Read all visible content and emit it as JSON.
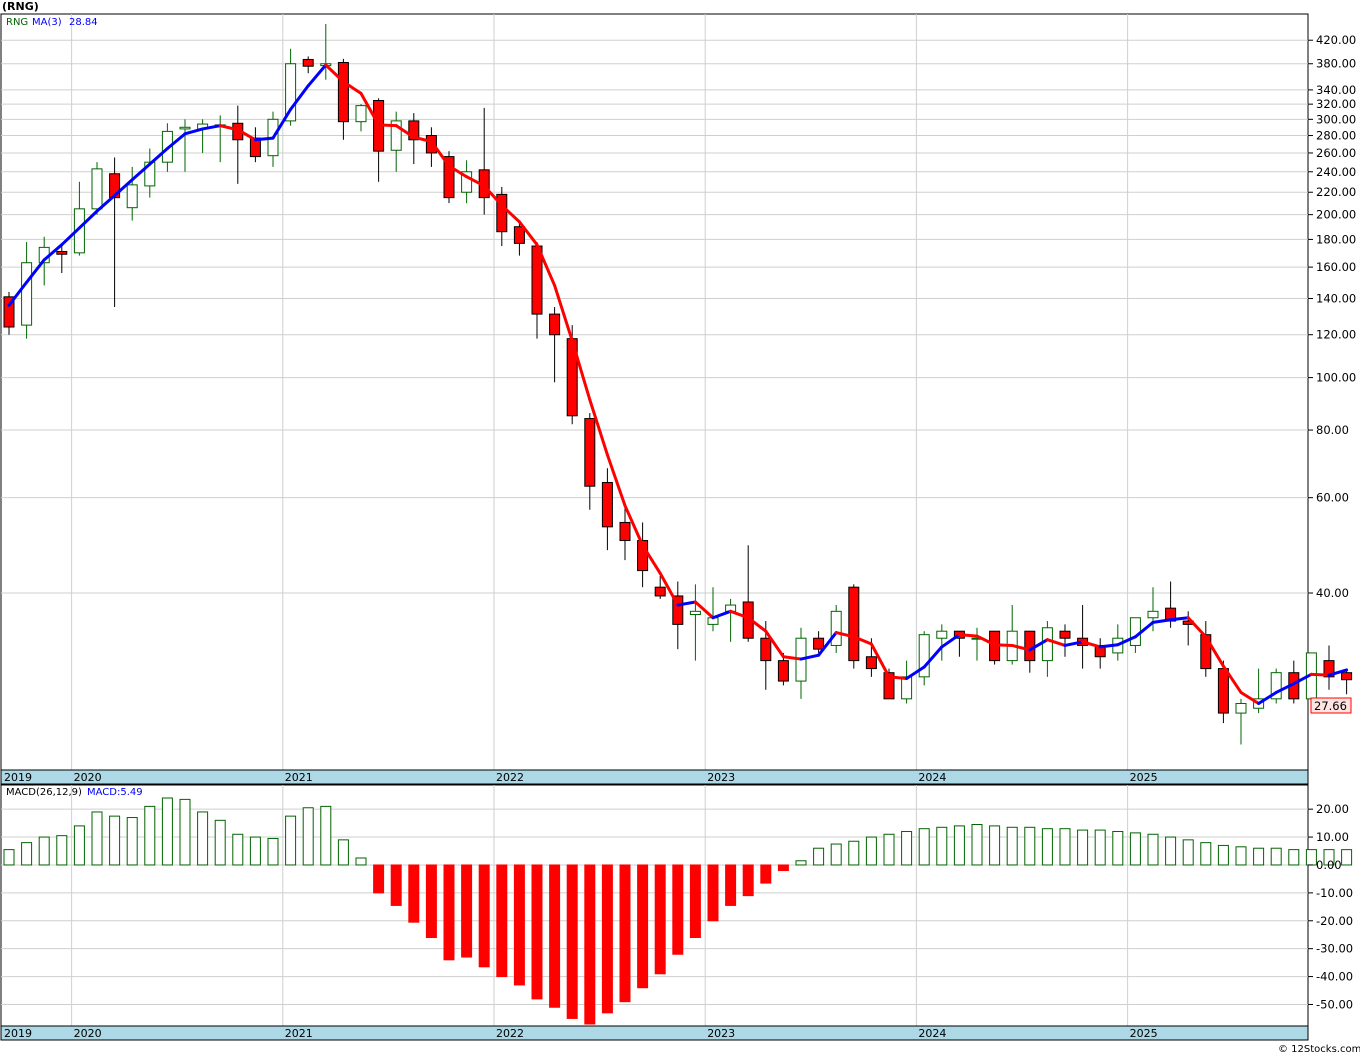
{
  "title": "(RNG)",
  "legend": {
    "symbol": "RNG",
    "ma_label": "MA(3)",
    "ma_value": "28.84"
  },
  "last_price": "27.66",
  "macd_label": "MACD(26,12,9)",
  "macd_value": "MACD:5.49",
  "watermark": "© 12Stocks.com",
  "colors": {
    "up": "#006400",
    "down": "#ff0000",
    "ma_up": "#0000ff",
    "ma_down": "#ff0000",
    "axis_band": "#add8e6"
  },
  "chart_data": [
    {
      "type": "candlestick",
      "scale": "log",
      "ylim": [
        19,
        450
      ],
      "y_ticks": [
        420,
        380,
        340,
        320,
        300,
        280,
        260,
        240,
        220,
        200,
        180,
        160,
        140,
        120,
        100,
        80,
        60,
        40
      ],
      "y_tick_labels": [
        "420.00",
        "380.00",
        "340.00",
        "320.00",
        "300.00",
        "280.00",
        "260.00",
        "240.00",
        "220.00",
        "200.00",
        "180.00",
        "160.00",
        "140.00",
        "120.00",
        "100.00",
        "80.00",
        "60.00",
        "40.00"
      ],
      "x_years": [
        "2019",
        "2020",
        "2021",
        "2022",
        "2023",
        "2024",
        "2025"
      ],
      "series": [
        {
          "name": "RNG",
          "ohlc": [
            [
              141,
              144,
              120,
              124
            ],
            [
              125,
              178,
              118,
              163
            ],
            [
              163,
              182,
              148,
              174
            ],
            [
              171,
              176,
              156,
              169
            ],
            [
              170,
              230,
              168,
              205
            ],
            [
              205,
              250,
              200,
              243
            ],
            [
              238,
              255,
              135,
              215
            ],
            [
              206,
              245,
              195,
              227
            ],
            [
              226,
              265,
              215,
              250
            ],
            [
              250,
              295,
              240,
              285
            ],
            [
              288,
              300,
              240,
              290
            ],
            [
              288,
              300,
              260,
              294
            ],
            [
              292,
              305,
              250,
              293
            ],
            [
              295,
              318,
              228,
              275
            ],
            [
              277,
              290,
              250,
              256
            ],
            [
              257,
              310,
              245,
              300
            ],
            [
              298,
              405,
              292,
              380
            ],
            [
              387,
              392,
              365,
              376
            ],
            [
              377,
              450,
              355,
              380
            ],
            [
              382,
              388,
              275,
              297
            ],
            [
              297,
              320,
              285,
              318
            ],
            [
              325,
              328,
              230,
              262
            ],
            [
              263,
              310,
              240,
              298
            ],
            [
              298,
              308,
              248,
              275
            ],
            [
              280,
              290,
              245,
              260
            ],
            [
              256,
              262,
              210,
              215
            ],
            [
              220,
              252,
              210,
              240
            ],
            [
              242,
              315,
              200,
              215
            ],
            [
              218,
              225,
              175,
              186
            ],
            [
              190,
              195,
              168,
              177
            ],
            [
              175,
              178,
              118,
              131
            ],
            [
              131,
              135,
              98,
              120
            ],
            [
              118,
              125,
              82,
              85
            ],
            [
              84,
              86,
              57,
              63
            ],
            [
              64,
              68,
              48,
              53
            ],
            [
              54,
              58,
              46,
              50
            ],
            [
              50,
              54,
              41,
              44
            ],
            [
              41,
              43,
              39,
              39.5
            ],
            [
              39.5,
              42,
              31.5,
              35
            ],
            [
              36.5,
              41.5,
              30,
              37
            ],
            [
              35,
              41,
              34,
              36
            ],
            [
              37,
              39,
              32.5,
              38
            ],
            [
              38.5,
              49,
              32.5,
              33
            ],
            [
              33,
              35.5,
              26.5,
              30
            ],
            [
              30,
              31,
              27,
              27.5
            ],
            [
              27.5,
              34.5,
              25.5,
              33
            ],
            [
              33,
              34,
              31,
              31.5
            ],
            [
              32,
              38,
              31,
              37
            ],
            [
              41,
              41.5,
              29,
              30
            ],
            [
              30.5,
              33,
              28,
              29
            ],
            [
              28.5,
              29,
              25.5,
              25.5
            ],
            [
              25.5,
              30,
              25,
              28
            ],
            [
              28,
              34,
              27,
              33.5
            ],
            [
              33,
              35,
              30,
              34
            ],
            [
              34,
              34,
              30.5,
              33
            ],
            [
              33,
              34.5,
              30,
              33
            ],
            [
              34,
              34,
              29.5,
              30
            ],
            [
              30,
              38,
              29.5,
              34
            ],
            [
              34,
              34,
              28.5,
              30
            ],
            [
              30,
              35.5,
              28,
              34.5
            ],
            [
              34,
              35,
              30.5,
              33
            ],
            [
              33,
              38,
              29,
              32
            ],
            [
              32,
              33,
              29,
              30.5
            ],
            [
              31,
              35,
              30,
              33
            ],
            [
              32,
              36,
              31,
              36
            ],
            [
              36,
              41,
              34,
              37
            ],
            [
              37.5,
              42,
              34.5,
              35.5
            ],
            [
              35.5,
              37,
              32,
              35
            ],
            [
              33.5,
              35.5,
              28,
              29
            ],
            [
              29,
              30,
              23,
              24
            ],
            [
              24,
              25.5,
              21,
              25
            ],
            [
              24.5,
              29,
              24,
              25.5
            ],
            [
              25.5,
              29,
              25,
              28.5
            ],
            [
              28.5,
              30,
              25,
              25.5
            ],
            [
              25.5,
              31,
              24,
              31
            ],
            [
              30,
              32,
              26.5,
              28
            ],
            [
              28.5,
              29,
              26,
              27.66
            ]
          ],
          "ma3": [
            136,
            150,
            165,
            176,
            189,
            203,
            217,
            232,
            248,
            265,
            282,
            288,
            292,
            287,
            275,
            277,
            313,
            346,
            378,
            352,
            335,
            293,
            292,
            278,
            273,
            246,
            235,
            226,
            208,
            194,
            176,
            148,
            117,
            91,
            72,
            58,
            49,
            43.5,
            38,
            38.5,
            36,
            37,
            36,
            34,
            30.5,
            30.2,
            30.7,
            33.8,
            33.2,
            32.2,
            28,
            27.8,
            29.2,
            31.8,
            33.5,
            33.3,
            32.1,
            32,
            31.4,
            32.8,
            32,
            32.5,
            31.8,
            32.1,
            33.2,
            35.3,
            35.7,
            36,
            33.2,
            29.3,
            26.2,
            25,
            26.2,
            27.2,
            28.3,
            28.2,
            28.84
          ]
        }
      ]
    },
    {
      "type": "bar",
      "name": "MACD(26,12,9)",
      "ylim": [
        -57,
        24
      ],
      "y_ticks": [
        20,
        10,
        0,
        -10,
        -20,
        -30,
        -40,
        -50
      ],
      "y_tick_labels": [
        "20.00",
        "10.00",
        "0.00",
        "-10.00",
        "-20.00",
        "-30.00",
        "-40.00",
        "-50.00"
      ],
      "values": [
        5.5,
        8,
        10,
        10.5,
        14,
        19,
        17.5,
        17,
        21,
        24,
        23.5,
        19,
        16,
        11,
        10,
        9.5,
        17.5,
        20.5,
        21,
        9,
        2.5,
        -10,
        -14.5,
        -20.5,
        -26,
        -34,
        -33,
        -36.5,
        -40,
        -43,
        -48,
        -51,
        -55,
        -57,
        -53,
        -49,
        -44,
        -39,
        -32,
        -26,
        -20,
        -14.5,
        -11,
        -6.5,
        -2,
        1.5,
        6,
        7.5,
        8.5,
        10,
        11,
        12,
        13,
        13.5,
        14,
        14.5,
        14,
        13.5,
        13.5,
        13,
        13,
        12.5,
        12.5,
        12,
        11.5,
        11,
        10,
        9,
        8,
        7,
        6.5,
        6,
        6,
        5.5,
        5.5,
        5.5,
        5.49
      ]
    }
  ]
}
